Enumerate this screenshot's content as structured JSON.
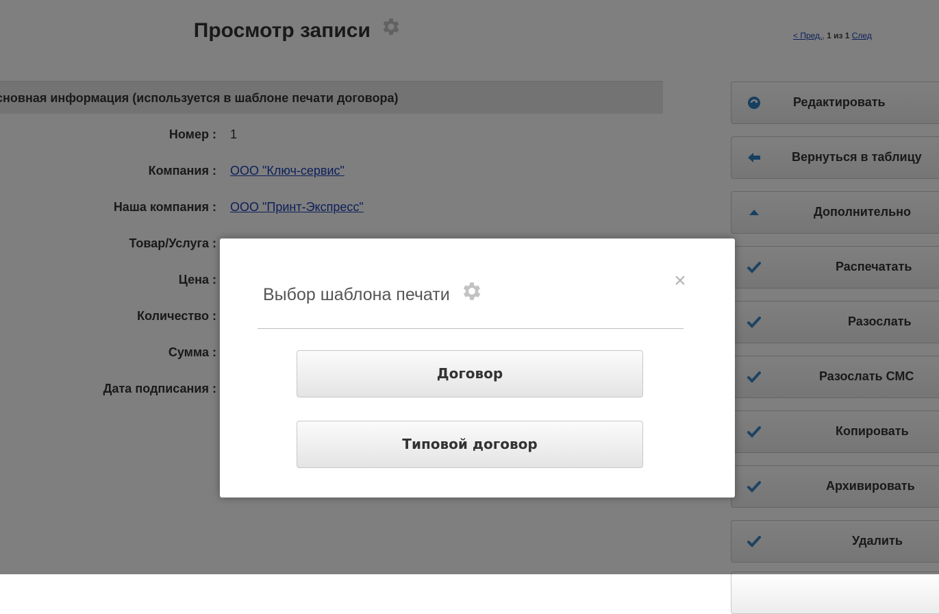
{
  "page": {
    "title": "Просмотр записи",
    "pager": {
      "prev": "< Пред.",
      "position": "1 из 1",
      "next": "След"
    }
  },
  "section": {
    "header": "Основная информация (используется в шаблоне печати договора)"
  },
  "fields": [
    {
      "label": "Номер :",
      "value": "1",
      "is_link": false
    },
    {
      "label": "Компания :",
      "value": "ООО \"Ключ-сервис\"",
      "is_link": true
    },
    {
      "label": "Наша компания :",
      "value": "ООО \"Принт-Экспресс\"",
      "is_link": true
    },
    {
      "label": "Товар/Услуга :",
      "value": "",
      "is_link": false
    },
    {
      "label": "Цена :",
      "value": "",
      "is_link": false
    },
    {
      "label": "Количество :",
      "value": "",
      "is_link": false
    },
    {
      "label": "Сумма :",
      "value": "",
      "is_link": false
    },
    {
      "label": "Дата подписания :",
      "value": "",
      "is_link": false
    }
  ],
  "sidebar": {
    "buttons": [
      {
        "label": "Редактировать",
        "icon": "refresh-icon"
      },
      {
        "label": "Вернуться в таблицу",
        "icon": "arrow-left-icon"
      },
      {
        "label": "Дополнительно",
        "icon": "triangle-up-icon"
      },
      {
        "label": "Распечатать",
        "icon": "check-icon"
      },
      {
        "label": "Разослать",
        "icon": "check-icon"
      },
      {
        "label": "Разослать СМС",
        "icon": "check-icon"
      },
      {
        "label": "Копировать",
        "icon": "check-icon"
      },
      {
        "label": "Архивировать",
        "icon": "check-icon"
      },
      {
        "label": "Удалить",
        "icon": "check-icon"
      }
    ]
  },
  "modal": {
    "title": "Выбор шаблона печати",
    "close_symbol": "×",
    "options": [
      "Договор",
      "Типовой договор"
    ]
  },
  "colors": {
    "link": "#1a3fb4",
    "icon_blue": "#2f7fc1",
    "check_blue": "#3b86c4",
    "gear": "#c2c2c2",
    "overlay": "rgba(0,0,0,0.5)"
  }
}
